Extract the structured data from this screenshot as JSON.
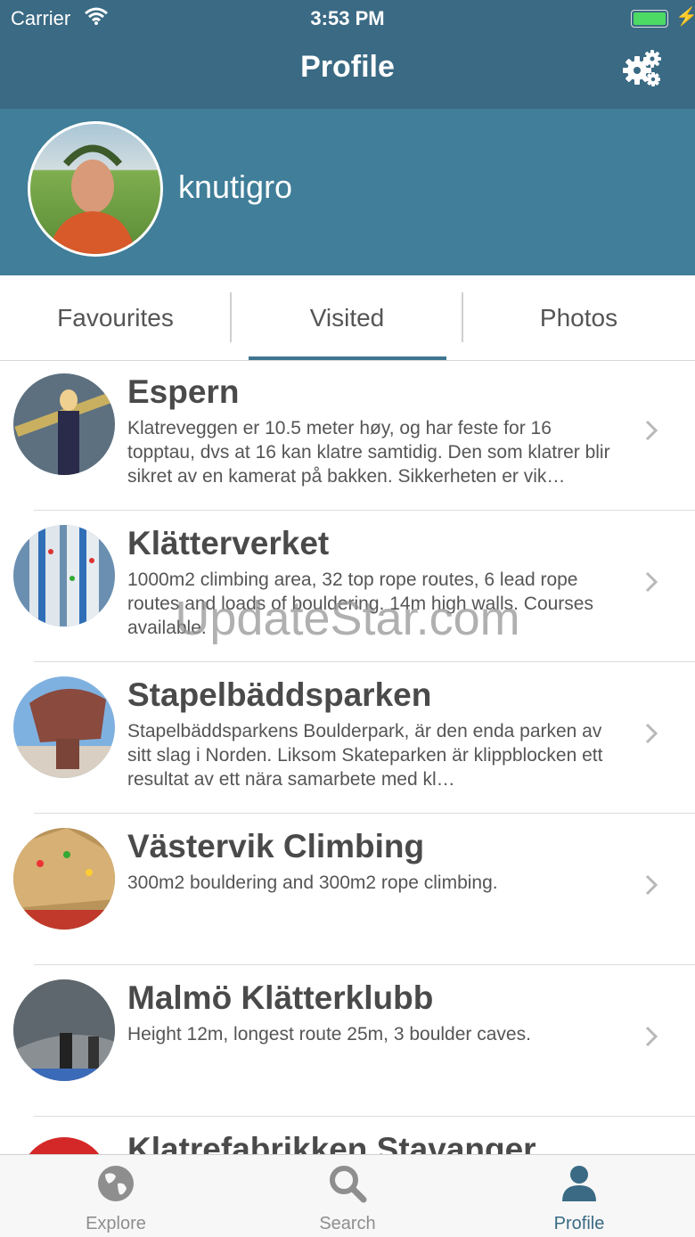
{
  "status_bar": {
    "carrier": "Carrier",
    "time": "3:53 PM",
    "battery_level": 1.0
  },
  "nav": {
    "title": "Profile",
    "settings_icon": "gears-icon"
  },
  "profile": {
    "username": "knutigro"
  },
  "tabs": [
    {
      "label": "Favourites",
      "selected": false
    },
    {
      "label": "Visited",
      "selected": true
    },
    {
      "label": "Photos",
      "selected": false
    }
  ],
  "list": [
    {
      "title": "Espern",
      "description": "Klatreveggen er 10.5 meter høy, og har feste for 16 topptau, dvs at 16 kan klatre samtidig. Den som klatrer blir sikret av en kamerat på bakken. Sikkerheten er vik…"
    },
    {
      "title": "Klätterverket",
      "description": "1000m2 climbing area, 32 top rope routes, 6 lead rope routes and loads of bouldering. 14m high walls. Courses available."
    },
    {
      "title": "Stapelbäddsparken",
      "description": "Stapelbäddsparkens Boulderpark, är den enda parken av sitt slag i Norden. Liksom Skateparken är klippblocken ett resultat av ett nära samarbete med kl…"
    },
    {
      "title": "Västervik Climbing",
      "description": "300m2 bouldering and 300m2 rope climbing."
    },
    {
      "title": "Malmö Klätterklubb",
      "description": "Height 12m, longest route 25m, 3 boulder caves."
    },
    {
      "title": "Klatrefabrikken Stavanger",
      "description": ""
    }
  ],
  "watermark": "UpdateStar.com",
  "tabbar": [
    {
      "label": "Explore",
      "icon": "globe-icon",
      "active": false
    },
    {
      "label": "Search",
      "icon": "search-icon",
      "active": false
    },
    {
      "label": "Profile",
      "icon": "person-icon",
      "active": true
    }
  ],
  "colors": {
    "header": "#3a6a84",
    "profile_band": "#407e99",
    "accent": "#3e7590"
  }
}
